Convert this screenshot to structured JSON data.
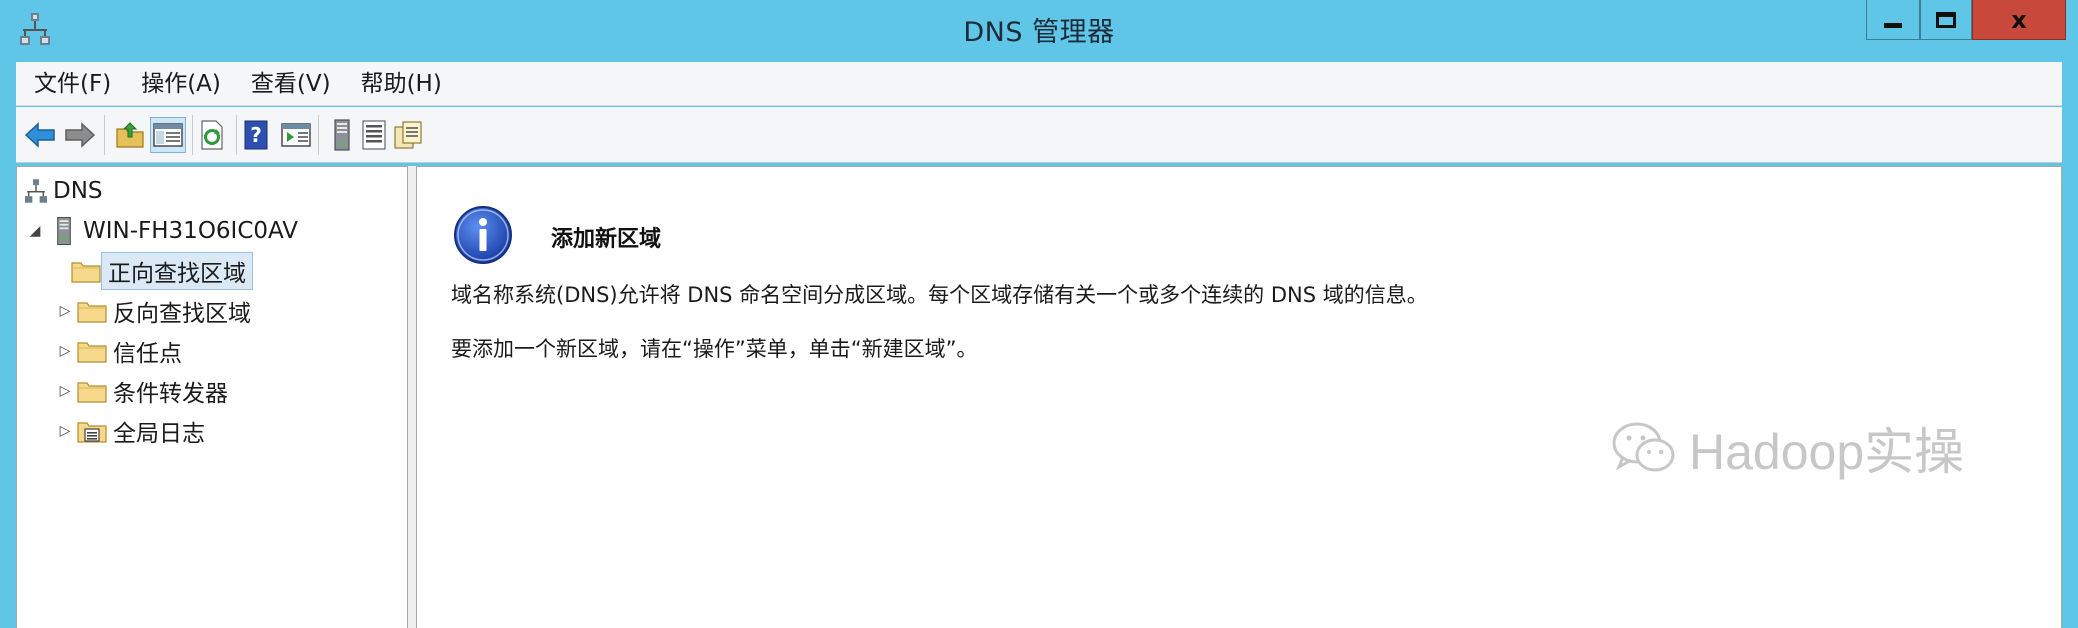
{
  "window": {
    "title": "DNS 管理器"
  },
  "menu": [
    "文件(F)",
    "操作(A)",
    "查看(V)",
    "帮助(H)"
  ],
  "toolbar": {
    "icons": [
      "back-arrow-icon",
      "forward-arrow-icon",
      "up-folder-icon",
      "show-hide-console-tree-icon",
      "refresh-icon",
      "help-icon",
      "action-pane-icon",
      "server-icon",
      "list-view-icon",
      "detail-view-icon"
    ],
    "active": "show-hide-console-tree-icon"
  },
  "tree": {
    "root": "DNS",
    "server": "WIN-FH31O6IC0AV",
    "children": [
      "正向查找区域",
      "反向查找区域",
      "信任点",
      "条件转发器",
      "全局日志"
    ],
    "selected": "正向查找区域"
  },
  "content": {
    "heading": "添加新区域",
    "line1": "域名称系统(DNS)允许将 DNS 命名空间分成区域。每个区域存储有关一个或多个连续的 DNS 域的信息。",
    "line2": "要添加一个新区域，请在“操作”菜单，单击“新建区域”。"
  },
  "watermark": {
    "text": "Hadoop实操"
  },
  "colors": {
    "titlebar": "#5fc6e8",
    "close": "#c9483c",
    "selection": "#dbe9f6"
  }
}
